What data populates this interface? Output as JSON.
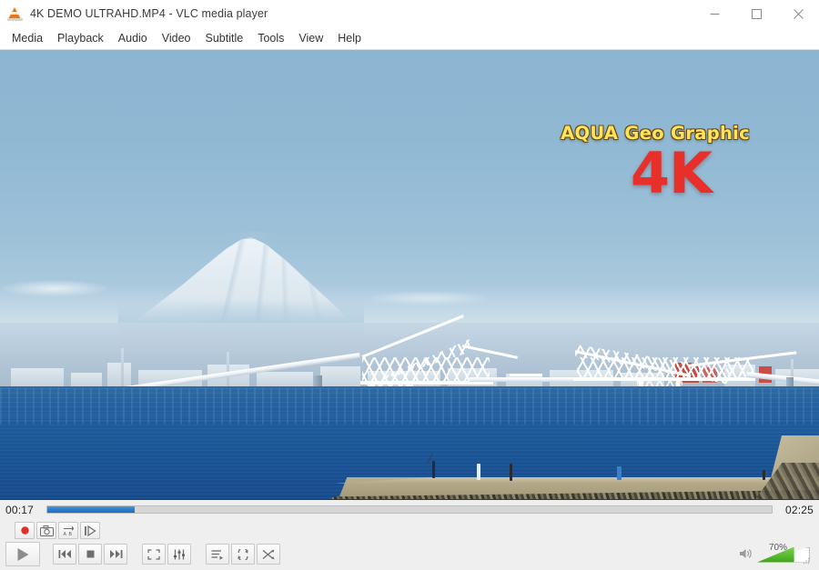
{
  "window": {
    "title": "4K DEMO ULTRAHD.MP4 - VLC media player",
    "app_icon": "vlc-cone-icon",
    "controls": {
      "minimize": "minimize-icon",
      "maximize": "maximize-icon",
      "close": "close-icon"
    }
  },
  "menubar": {
    "items": [
      {
        "label": "Media"
      },
      {
        "label": "Playback"
      },
      {
        "label": "Audio"
      },
      {
        "label": "Video"
      },
      {
        "label": "Subtitle"
      },
      {
        "label": "Tools"
      },
      {
        "label": "View"
      },
      {
        "label": "Help"
      }
    ]
  },
  "video": {
    "scene": "Mount Fuji and Tokyo Gate Bridge over Tokyo Bay",
    "watermark": {
      "brand": "AQUA Geo Graphic",
      "resolution": "4K",
      "brand_color": "#ffe45c",
      "brand_outline_color": "#6b4a12",
      "resolution_color": "#e8302a"
    },
    "colors": {
      "sky": "#8cb5d2",
      "sky_horizon": "#b9d2e2",
      "sea": "#1f5b9b",
      "sea_deep": "#174c8c",
      "mountain_snow": "#f4f8fa",
      "bridge": "#ffffff",
      "breakwater": "#a89d7d",
      "crane_red": "#c8443a"
    }
  },
  "seekbar": {
    "elapsed": "00:17",
    "total": "02:25",
    "progress_percent": 12,
    "fill_color": "#2e7fcb",
    "track_color": "#d6d6d6"
  },
  "toolbar": {
    "advanced_buttons": [
      {
        "name": "record-button",
        "label": "Record",
        "icon": "record-icon"
      },
      {
        "name": "snapshot-button",
        "label": "Take Snapshot",
        "icon": "camera-icon"
      },
      {
        "name": "ab-loop-button",
        "label": "Loop from A to B",
        "icon": "ab-loop-icon"
      },
      {
        "name": "frame-button",
        "label": "Frame by Frame",
        "icon": "frame-step-icon"
      }
    ],
    "transport_buttons": [
      {
        "name": "play-button",
        "label": "Play",
        "icon": "play-icon"
      },
      {
        "name": "previous-button",
        "label": "Previous",
        "icon": "previous-icon"
      },
      {
        "name": "stop-button",
        "label": "Stop",
        "icon": "stop-icon"
      },
      {
        "name": "next-button",
        "label": "Next",
        "icon": "next-icon"
      }
    ],
    "tool_buttons": [
      {
        "name": "fullscreen-button",
        "label": "Toggle Fullscreen",
        "icon": "fullscreen-icon"
      },
      {
        "name": "extended-settings-button",
        "label": "Show Extended Settings",
        "icon": "equalizer-icon"
      },
      {
        "name": "playlist-button",
        "label": "Show Playlist",
        "icon": "playlist-icon"
      },
      {
        "name": "loop-button",
        "label": "Loop",
        "icon": "loop-icon"
      },
      {
        "name": "shuffle-button",
        "label": "Random",
        "icon": "shuffle-icon"
      }
    ],
    "volume": {
      "label": "70%",
      "value": 70,
      "icon": "speaker-icon",
      "fill_color": "#3fa31c"
    }
  }
}
